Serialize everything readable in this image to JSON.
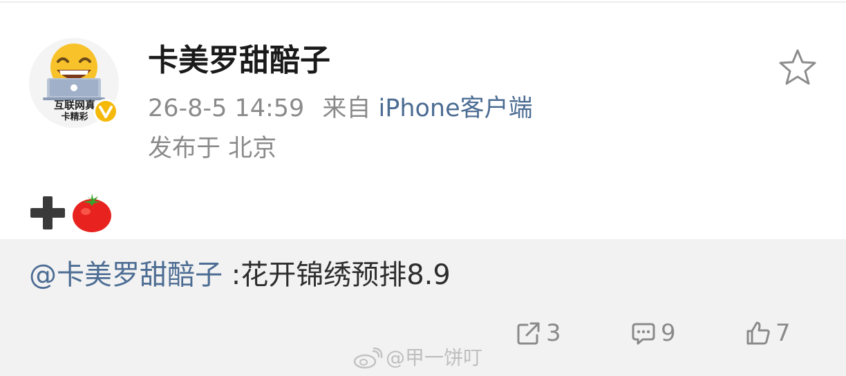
{
  "post": {
    "username": "卡美罗甜醅子",
    "avatar": {
      "caption_line1": "互联网真",
      "caption_line2": "卡精彩"
    },
    "timestamp": "26-8-5 14:59",
    "source_prefix": "来自",
    "source_client": "iPhone客户端",
    "location": "发布于 北京",
    "content_emojis": [
      "heavy-plus-icon",
      "tomato-icon"
    ]
  },
  "repost": {
    "mention": "@卡美罗甜醅子",
    "text": " :花开锦绣预排8.9"
  },
  "actions": {
    "repost_count": "3",
    "comment_count": "9",
    "like_count": "7"
  },
  "watermark": {
    "handle": "@甲一饼叮"
  },
  "colors": {
    "link_blue": "#4c6c93",
    "meta_gray": "#8a8a8a",
    "repost_bg": "#f2f2f2",
    "badge_gold": "#f5b90a"
  }
}
